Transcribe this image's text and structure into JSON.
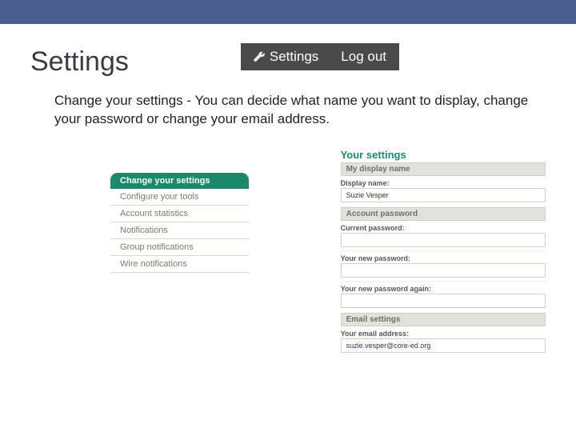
{
  "header": {
    "title": "Settings",
    "darkbar": {
      "settings": "Settings",
      "logout": "Log out"
    }
  },
  "description": "Change your settings - You can decide what name you want to display, change your password or change your email address.",
  "sidenav": {
    "items": [
      {
        "label": "Change your settings",
        "active": true
      },
      {
        "label": "Configure your tools",
        "active": false
      },
      {
        "label": "Account statistics",
        "active": false
      },
      {
        "label": "Notifications",
        "active": false
      },
      {
        "label": "Group notifications",
        "active": false
      },
      {
        "label": "Wire notifications",
        "active": false
      }
    ]
  },
  "panel": {
    "heading": "Your settings",
    "sections": {
      "display_name": {
        "subhead": "My display name",
        "label": "Display name:",
        "value": "Suzie Vesper"
      },
      "password": {
        "subhead": "Account password",
        "current_label": "Current password:",
        "current_value": "",
        "new_label": "Your new password:",
        "new_value": "",
        "again_label": "Your new password again:",
        "again_value": ""
      },
      "email": {
        "subhead": "Email settings",
        "label": "Your email address:",
        "value": "suzie.vesper@core-ed.org"
      }
    }
  }
}
